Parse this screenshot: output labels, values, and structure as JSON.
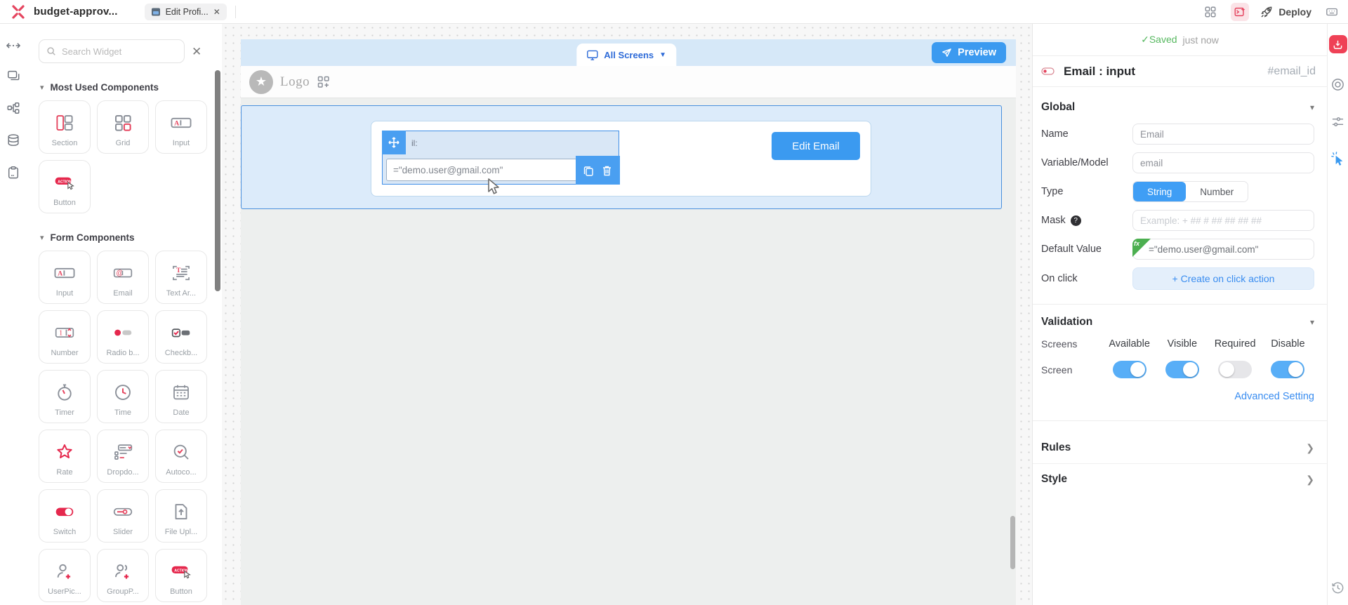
{
  "topbar": {
    "app_title": "budget-approv...",
    "tab_label": "Edit Profi...",
    "tab_close": "✕",
    "deploy_label": "Deploy"
  },
  "sidebar": {
    "search_placeholder": "Search Widget",
    "clear_glyph": "✕",
    "most_used": {
      "title": "Most Used Components",
      "items": [
        {
          "label": "Section"
        },
        {
          "label": "Grid"
        },
        {
          "label": "Input"
        },
        {
          "label": "Button"
        }
      ]
    },
    "form": {
      "title": "Form Components",
      "items": [
        {
          "label": "Input"
        },
        {
          "label": "Email"
        },
        {
          "label": "Text Ar..."
        },
        {
          "label": "Number"
        },
        {
          "label": "Radio b..."
        },
        {
          "label": "Checkb..."
        },
        {
          "label": "Timer"
        },
        {
          "label": "Time"
        },
        {
          "label": "Date"
        },
        {
          "label": "Rate"
        },
        {
          "label": "Dropdo..."
        },
        {
          "label": "Autoco..."
        },
        {
          "label": "Switch"
        },
        {
          "label": "Slider"
        },
        {
          "label": "File Upl..."
        },
        {
          "label": "UserPic..."
        },
        {
          "label": "GroupP..."
        },
        {
          "label": "Button"
        }
      ]
    }
  },
  "canvas": {
    "screens_tab": "All Screens",
    "preview_label": "Preview",
    "logo_label": "Logo",
    "widget": {
      "label_fragment": "il:",
      "value": "=\"demo.user@gmail.com\"",
      "edit_button": "Edit Email"
    }
  },
  "inspector": {
    "saved_status": "✓Saved",
    "saved_time": "just now",
    "widget_title": "Email : input",
    "widget_id": "#email_id",
    "global": {
      "title": "Global",
      "name_label": "Name",
      "name_value": "Email",
      "variable_label": "Variable/Model",
      "variable_value": "email",
      "type_label": "Type",
      "type_options": [
        "String",
        "Number"
      ],
      "type_selected": "String",
      "mask_label": "Mask",
      "mask_help_glyph": "?",
      "mask_placeholder": "Example: + ## # ## ## ## ##",
      "default_label": "Default Value",
      "fx_badge": "fx",
      "default_value": "=\"demo.user@gmail.com\"",
      "onclick_label": "On click",
      "onclick_button": "+  Create on click action"
    },
    "validation": {
      "title": "Validation",
      "columns": [
        "Screens",
        "Available",
        "Visible",
        "Required",
        "Disable"
      ],
      "rows": [
        {
          "name": "Screen",
          "available": true,
          "visible": true,
          "required": false,
          "disable": true
        }
      ],
      "advanced_link": "Advanced Setting"
    },
    "rules_label": "Rules",
    "style_label": "Style"
  },
  "colors": {
    "accent_blue": "#3b9af0",
    "toggle_blue": "#58aef7",
    "brand_red": "#e5455f",
    "saved_green": "#57b860",
    "selection_blue": "#3f8fe8",
    "section_fill": "#dcebfa",
    "screenbar_fill": "#d6e8f8"
  }
}
